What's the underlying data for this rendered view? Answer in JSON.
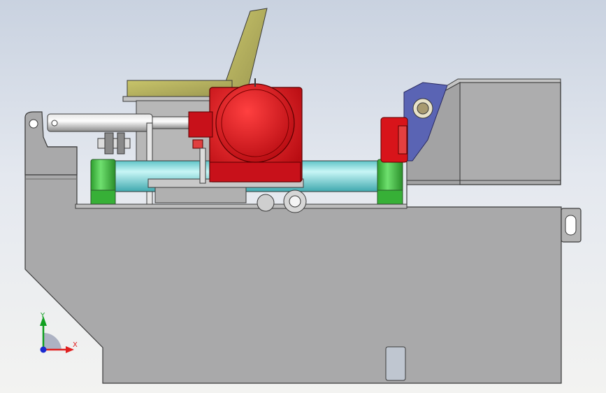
{
  "triad": {
    "x_label": "X",
    "y_label": "Y",
    "x_color": "#e02020",
    "y_color": "#10a020",
    "z_color": "#1a2ad0"
  },
  "palette": {
    "frame": "#a9a9aa",
    "frame_edge": "#3a3a3a",
    "motor_red": "#d8141a",
    "motor_dark": "#9a0c10",
    "shaft_cyan": "#7fe0e0",
    "coupling_green": "#3ec43e",
    "chute_olive": "#b7b35c",
    "bearing_blue": "#5a64b4"
  }
}
